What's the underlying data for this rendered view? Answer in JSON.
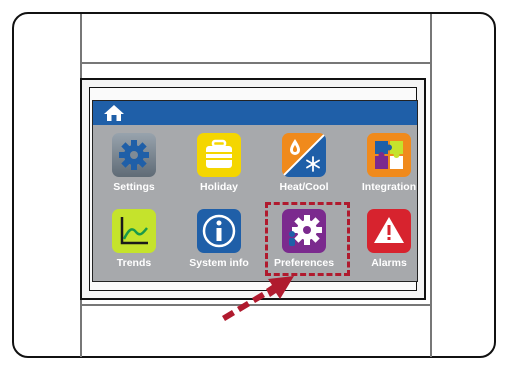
{
  "home": {
    "icon": "home-icon"
  },
  "apps": [
    {
      "label": "Settings",
      "icon": "gear-icon",
      "color": "#7f8b96"
    },
    {
      "label": "Holiday",
      "icon": "suitcase-icon",
      "color": "#f4d600"
    },
    {
      "label": "Heat/Cool",
      "icon": "flame-snowflake-icon",
      "color": "#f08a1c"
    },
    {
      "label": "Integration",
      "icon": "puzzle-icon",
      "color": "#f08a1c"
    },
    {
      "label": "Trends",
      "icon": "chart-icon",
      "color": "#c5e32c"
    },
    {
      "label": "System info",
      "icon": "info-icon",
      "color": "#1f5fa8"
    },
    {
      "label": "Preferences",
      "icon": "user-gear-icon",
      "color": "#7b2a8e"
    },
    {
      "label": "Alarms",
      "icon": "warning-icon",
      "color": "#d7232e"
    }
  ],
  "highlight_color": "#b01a2e"
}
